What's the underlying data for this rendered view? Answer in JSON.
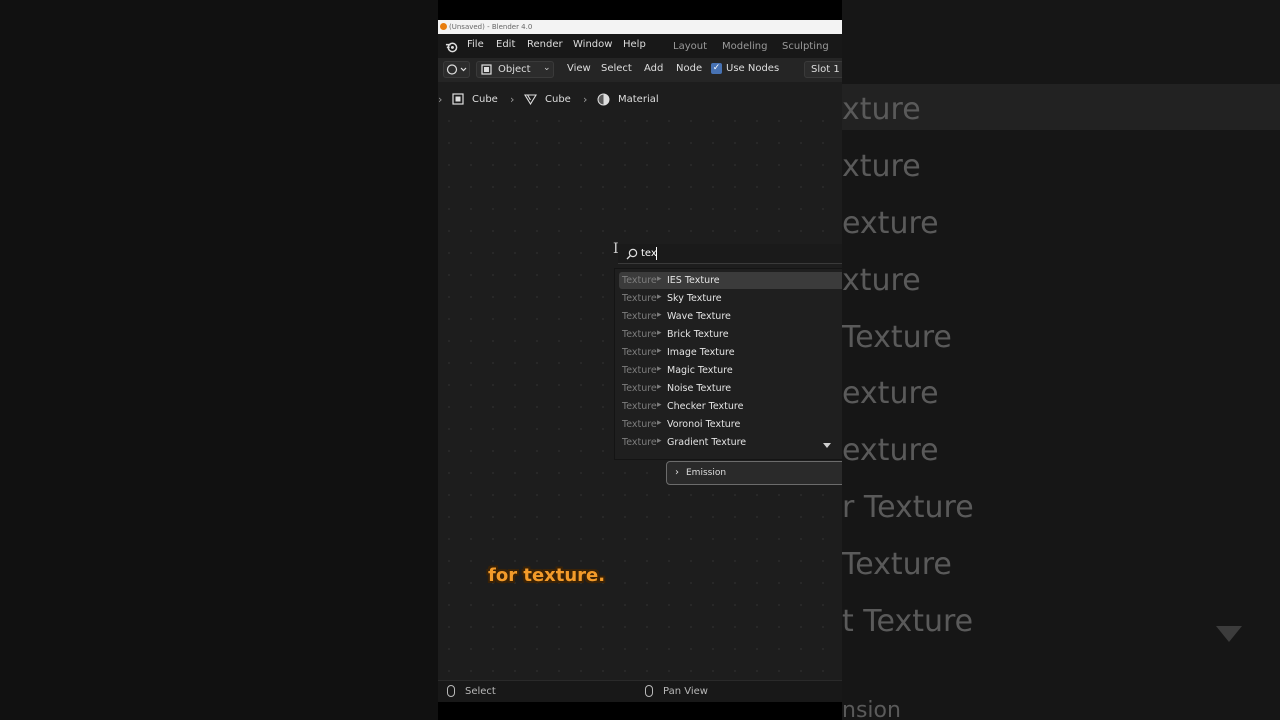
{
  "window": {
    "title": "(Unsaved) - Blender 4.0"
  },
  "menu": {
    "file": "File",
    "edit": "Edit",
    "render": "Render",
    "window": "Window",
    "help": "Help"
  },
  "workspaces": [
    "Layout",
    "Modeling",
    "Sculpting"
  ],
  "header": {
    "mode": "Object",
    "view": "View",
    "select": "Select",
    "add": "Add",
    "node": "Node",
    "use_nodes": "Use Nodes",
    "slot": "Slot 1"
  },
  "breadcrumb": {
    "object": "Cube",
    "mesh": "Cube",
    "material": "Material"
  },
  "search": {
    "query": "tex"
  },
  "results": [
    {
      "prefix": "Texture",
      "label": "IES Texture"
    },
    {
      "prefix": "Texture",
      "label": "Sky Texture"
    },
    {
      "prefix": "Texture",
      "label": "Wave Texture"
    },
    {
      "prefix": "Texture",
      "label": "Brick Texture"
    },
    {
      "prefix": "Texture",
      "label": "Image Texture"
    },
    {
      "prefix": "Texture",
      "label": "Magic Texture"
    },
    {
      "prefix": "Texture",
      "label": "Noise Texture"
    },
    {
      "prefix": "Texture",
      "label": "Checker Texture"
    },
    {
      "prefix": "Texture",
      "label": "Voronoi Texture"
    },
    {
      "prefix": "Texture",
      "label": "Gradient Texture"
    }
  ],
  "panel": {
    "emission": "Emission"
  },
  "caption": "for texture.",
  "status": {
    "select": "Select",
    "pan": "Pan View"
  },
  "background_items": [
    "xture",
    "xture",
    "exture",
    "xture",
    "Texture",
    "exture",
    "exture",
    "r Texture",
    "Texture",
    "t Texture",
    "nsion"
  ]
}
